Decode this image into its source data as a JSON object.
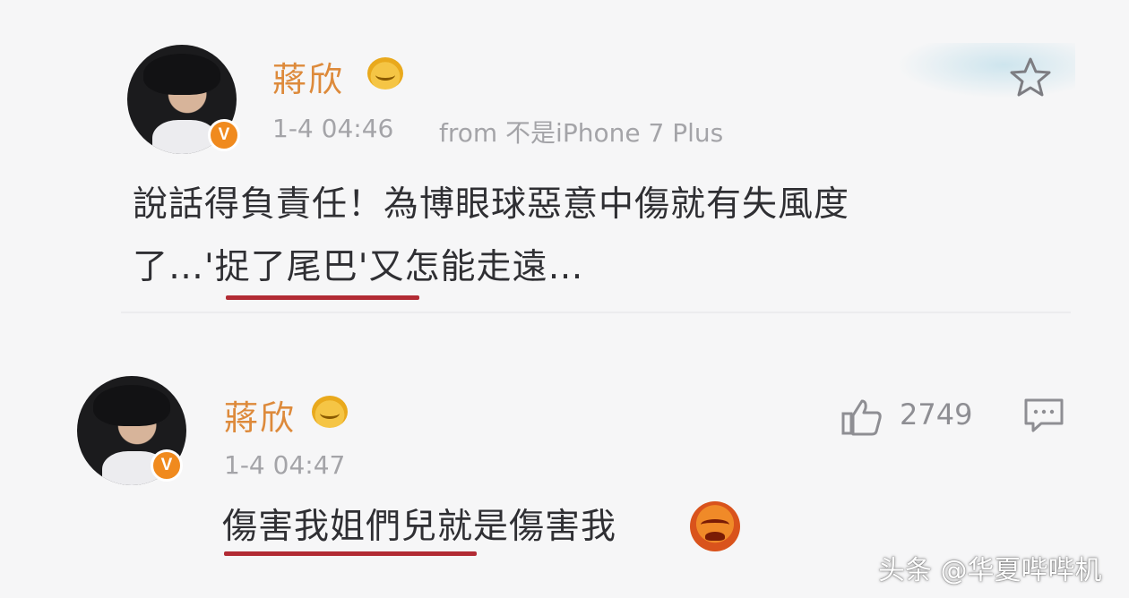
{
  "post": {
    "author": "蔣欣",
    "time": "1-4 04:46",
    "source": "from 不是iPhone 7 Plus",
    "text_line1": "說話得負責任！為博眼球惡意中傷就有失風度",
    "text_line2_before": "了…",
    "text_line2_highlight": "'捉了尾巴'",
    "text_line2_after": "又怎能走遠…",
    "verified_badge": "V",
    "icons": [
      "crown-emoji-icon",
      "star-icon"
    ]
  },
  "comment": {
    "author": "蔣欣",
    "time": "1-4 04:47",
    "text_highlight": "傷害我姐們兒",
    "text_after": "就是傷害我",
    "verified_badge": "V",
    "like_count": "2749",
    "icons": [
      "crown-emoji-icon",
      "like-icon",
      "comment-icon",
      "angry-emoji-icon"
    ]
  },
  "watermark": "头条 @华夏哔哔机",
  "colors": {
    "name": "#dd8a3b",
    "meta": "#a4a4a8",
    "underline": "#b22b34",
    "badge": "#f08a1e"
  }
}
